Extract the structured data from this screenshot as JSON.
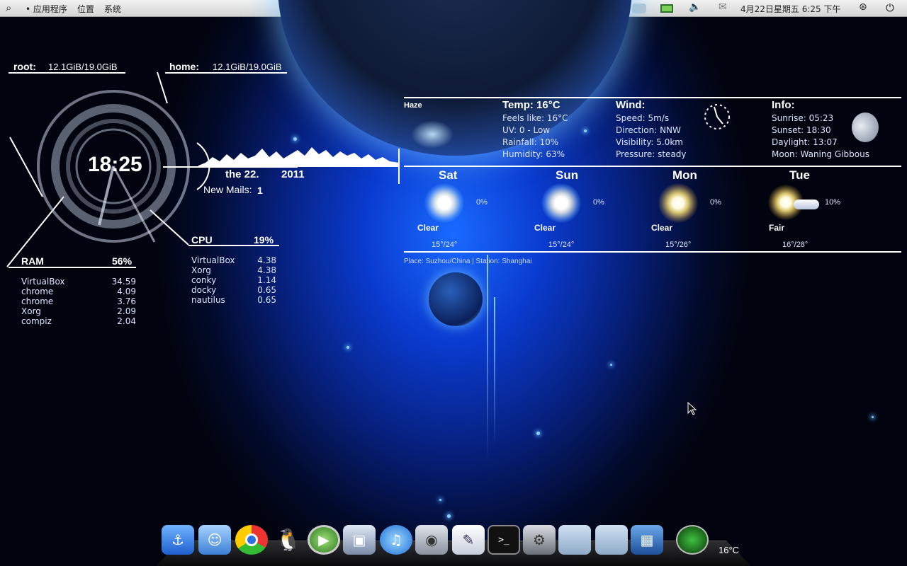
{
  "panel": {
    "menu_apps": "应用程序",
    "menu_places": "位置",
    "menu_system": "系统",
    "datetime": "4月22日星期五  6:25 下午"
  },
  "disk": {
    "root_label": "root:",
    "root_value": "12.1GiB/19.0GiB",
    "home_label": "home:",
    "home_value": "12.1GiB/19.0GiB"
  },
  "clock": {
    "time": "18:25",
    "day": "the 22.",
    "year": "2011"
  },
  "mail": {
    "label": "New Mails:",
    "count": "1"
  },
  "ram": {
    "label": "RAM",
    "percent": "56%",
    "processes": [
      {
        "name": "VirtualBox",
        "value": "34.59"
      },
      {
        "name": "chrome",
        "value": "4.09"
      },
      {
        "name": "chrome",
        "value": "3.76"
      },
      {
        "name": "Xorg",
        "value": "2.09"
      },
      {
        "name": "compiz",
        "value": "2.04"
      }
    ]
  },
  "cpu": {
    "label": "CPU",
    "percent": "19%",
    "processes": [
      {
        "name": "VirtualBox",
        "value": "4.38"
      },
      {
        "name": "Xorg",
        "value": "4.38"
      },
      {
        "name": "conky",
        "value": "1.14"
      },
      {
        "name": "docky",
        "value": "0.65"
      },
      {
        "name": "nautilus",
        "value": "0.65"
      }
    ]
  },
  "weather": {
    "condition": "Haze",
    "temp": "Temp:  16°C",
    "feels": "Feels like:  16°C",
    "uv": "UV:  0 - Low",
    "rain": "Rainfall:  10%",
    "humidity": "Humidity:  63%",
    "wind_title": "Wind:",
    "speed": "Speed:  5m/s",
    "direction": "Direction:  NNW",
    "visibility": "Visibility:  5.0km",
    "pressure": "Pressure:  steady",
    "info_title": "Info:",
    "sunrise": "Sunrise:  05:23",
    "sunset": "Sunset:  18:30",
    "daylight": "Daylight:  13:07",
    "moon": "Moon:  Waning Gibbous",
    "place": "Place:  Suzhou/China | Station:  Shanghai",
    "forecast": [
      {
        "day": "Sat",
        "pct": "0%",
        "cond": "Clear",
        "range": "15°/24°"
      },
      {
        "day": "Sun",
        "pct": "0%",
        "cond": "Clear",
        "range": "15°/24°"
      },
      {
        "day": "Mon",
        "pct": "0%",
        "cond": "Clear",
        "range": "15°/26°"
      },
      {
        "day": "Tue",
        "pct": "10%",
        "cond": "Fair",
        "range": "16°/28°"
      }
    ]
  },
  "dock": {
    "weather_temp": "16°C",
    "items": [
      "anchor",
      "finder",
      "chrome",
      "qq",
      "media-player",
      "photos",
      "itunes",
      "camera",
      "text-editor",
      "terminal",
      "system-settings",
      "folder",
      "folder",
      "virtualbox",
      "radar"
    ]
  }
}
